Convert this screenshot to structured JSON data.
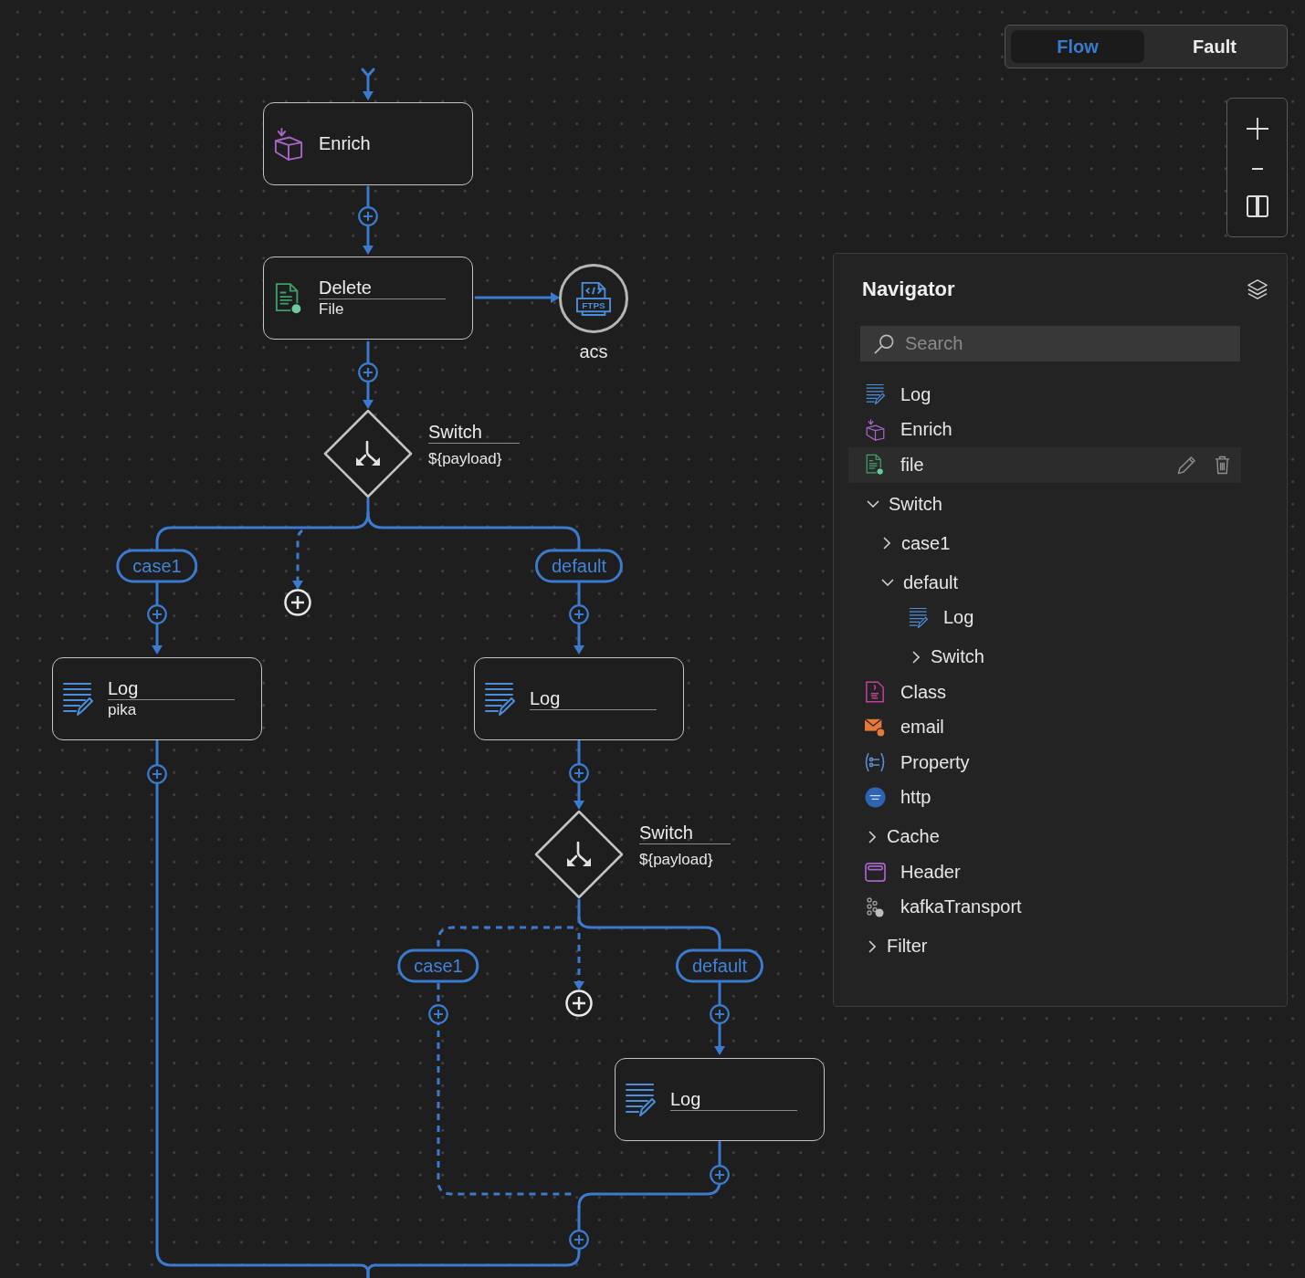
{
  "view_tabs": [
    {
      "label": "Flow",
      "selected": true
    },
    {
      "label": "Fault",
      "selected": false
    }
  ],
  "canvas": {
    "flow": [
      {
        "kind": "enrich",
        "title": "Enrich",
        "editable_name": false
      },
      {
        "kind": "file",
        "title": "Delete",
        "description": "File",
        "editable_name": true,
        "target": {
          "kind": "ftps",
          "icon_text": "FTPS",
          "label": "acs"
        }
      },
      {
        "kind": "switch",
        "title": "Switch",
        "expression": "${payload}",
        "editable_name": true,
        "branches": [
          {
            "label": "case1",
            "steps": [
              {
                "kind": "log",
                "title": "Log",
                "description": "pika",
                "editable_name": true
              }
            ]
          },
          {
            "label": "default",
            "steps": [
              {
                "kind": "log",
                "title": "Log",
                "editable_name": true
              },
              {
                "kind": "switch",
                "title": "Switch",
                "expression": "${payload}",
                "editable_name": true,
                "branches": [
                  {
                    "label": "case1"
                  },
                  {
                    "label": "default",
                    "steps": [
                      {
                        "kind": "log",
                        "title": "Log",
                        "editable_name": true
                      }
                    ]
                  }
                ]
              }
            ]
          }
        ]
      }
    ]
  },
  "navigator": {
    "title": "Navigator",
    "search": {
      "placeholder": "Search"
    },
    "items": [
      {
        "kind": "log",
        "label": "Log",
        "selected": false
      },
      {
        "kind": "enrich",
        "label": "Enrich",
        "selected": false
      },
      {
        "kind": "file",
        "label": "file",
        "selected": true
      },
      {
        "kind": "group",
        "label": "Switch",
        "expanded": true,
        "selected": false,
        "children": [
          {
            "kind": "group",
            "label": "case1",
            "expanded": false,
            "selected": false
          },
          {
            "kind": "group",
            "label": "default",
            "expanded": true,
            "selected": false,
            "children": [
              {
                "kind": "log",
                "label": "Log",
                "selected": false
              },
              {
                "kind": "group",
                "label": "Switch",
                "expanded": false,
                "selected": false
              }
            ]
          }
        ]
      },
      {
        "kind": "class",
        "label": "Class",
        "selected": false
      },
      {
        "kind": "email",
        "label": "email",
        "selected": false
      },
      {
        "kind": "property",
        "label": "Property",
        "selected": false
      },
      {
        "kind": "http",
        "label": "http",
        "selected": false
      },
      {
        "kind": "group",
        "label": "Cache",
        "expanded": false,
        "selected": false
      },
      {
        "kind": "header",
        "label": "Header",
        "selected": false
      },
      {
        "kind": "kafka",
        "label": "kafkaTransport",
        "selected": false
      },
      {
        "kind": "group",
        "label": "Filter",
        "expanded": false,
        "selected": false
      }
    ]
  }
}
